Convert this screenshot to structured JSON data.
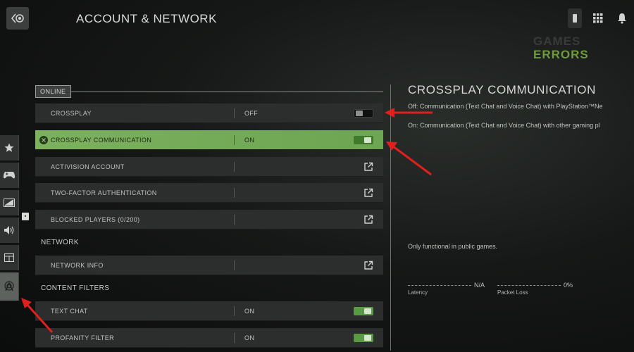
{
  "header": {
    "title": "ACCOUNT & NETWORK"
  },
  "watermark": {
    "line1": "GAMES",
    "line2": "ERRORS"
  },
  "sidebar": {
    "items": [
      {
        "icon": "star-icon"
      },
      {
        "icon": "gamepad-icon"
      },
      {
        "icon": "graphics-icon"
      },
      {
        "icon": "speaker-icon"
      },
      {
        "icon": "interface-icon"
      },
      {
        "icon": "network-icon"
      }
    ]
  },
  "sections": {
    "online": "ONLINE",
    "network": "NETWORK",
    "content_filters": "CONTENT FILTERS"
  },
  "rows": {
    "crossplay": {
      "label": "CROSSPLAY",
      "value": "OFF"
    },
    "crossplay_comm": {
      "label": "CROSSPLAY COMMUNICATION",
      "value": "ON"
    },
    "activision": {
      "label": "ACTIVISION ACCOUNT"
    },
    "two_factor": {
      "label": "TWO-FACTOR AUTHENTICATION"
    },
    "blocked": {
      "label": "BLOCKED PLAYERS (0/200)"
    },
    "network_info": {
      "label": "NETWORK INFO"
    },
    "text_chat": {
      "label": "TEXT CHAT",
      "value": "ON"
    },
    "profanity": {
      "label": "PROFANITY FILTER",
      "value": "ON"
    }
  },
  "detail": {
    "title": "CROSSPLAY COMMUNICATION",
    "off_text": "Off: Communication (Text Chat and Voice Chat) with PlayStation™Ne",
    "on_text": "On: Communication (Text Chat and Voice Chat) with other gaming pl",
    "note": "Only functional in public games."
  },
  "stats": {
    "latency_value": "N/A",
    "latency_label": "Latency",
    "packet_loss_value": "0%",
    "packet_loss_label": "Packet Loss"
  },
  "colors": {
    "accent": "#7cb15e",
    "arrow": "#e0201c"
  }
}
